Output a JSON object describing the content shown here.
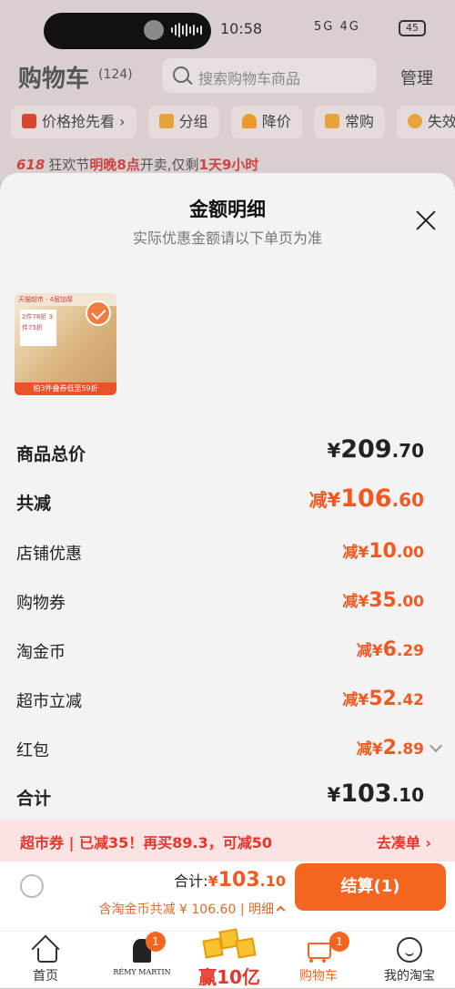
{
  "status_bar": {
    "time": "10:58",
    "battery": "45",
    "signal": "5G 4G"
  },
  "cart_header": {
    "title": "购物车",
    "count": "(124)",
    "search_placeholder": "搜索购物车商品",
    "manage": "管理"
  },
  "filter_chips": [
    {
      "label": "价格抢先看 ›",
      "icon": "price-tag-icon"
    },
    {
      "label": "分组",
      "icon": "folder-icon"
    },
    {
      "label": "降价",
      "icon": "down-arrow-icon"
    },
    {
      "label": "常购",
      "icon": "bag-icon"
    },
    {
      "label": "失效",
      "icon": "invalid-icon"
    }
  ],
  "promo_banner": {
    "tag": "618",
    "text1": "狂欢节",
    "highlight1": "明晚8点",
    "text2": "开卖,仅剩",
    "highlight2": "1天9小时"
  },
  "sheet": {
    "title": "金额明细",
    "subtitle": "实际优惠金额请以下单页为准",
    "product": {
      "top_text": "天猫超市 · 4层加厚",
      "badge_text": "2件78折 3件75折",
      "bottom_text": "拍3件叠券低至59折"
    },
    "rows": [
      {
        "label": "商品总价",
        "prefix": "",
        "yen": "¥",
        "int": "209",
        "dec": ".70",
        "style": "black-big"
      },
      {
        "label": "共减",
        "prefix": "减",
        "yen": "¥",
        "int": "106",
        "dec": ".60",
        "style": "orange-big"
      },
      {
        "label": "店铺优惠",
        "prefix": "减",
        "yen": "¥",
        "int": "10",
        "dec": ".00",
        "style": "orange-mid"
      },
      {
        "label": "购物券",
        "prefix": "减",
        "yen": "¥",
        "int": "35",
        "dec": ".00",
        "style": "orange-mid"
      },
      {
        "label": "淘金币",
        "prefix": "减",
        "yen": "¥",
        "int": "6",
        "dec": ".29",
        "style": "orange-mid"
      },
      {
        "label": "超市立减",
        "prefix": "减",
        "yen": "¥",
        "int": "52",
        "dec": ".42",
        "style": "orange-mid"
      },
      {
        "label": "红包",
        "prefix": "减",
        "yen": "¥",
        "int": "2",
        "dec": ".89",
        "style": "orange-mid"
      },
      {
        "label": "合计",
        "prefix": "",
        "yen": "¥",
        "int": "103",
        "dec": ".10",
        "style": "black-big"
      }
    ],
    "coupon": {
      "left": "超市券 | 已减35！再买89.3，可减50",
      "right": "去凑单 ›"
    }
  },
  "checkout": {
    "total_label": "合计:",
    "total_yen": "¥",
    "total_int": "103",
    "total_dec": ".10",
    "sub_text": "含淘金币共减 ¥ 106.60 |",
    "detail": "明细",
    "button": "结算(1)"
  },
  "bottom_nav": {
    "home": "首页",
    "brand_text": "RÉMY MARTIN",
    "brand_badge": "1",
    "promo_text": "赢10亿",
    "cart": "购物车",
    "cart_badge": "1",
    "profile": "我的淘宝"
  },
  "colors": {
    "accent": "#f4661f",
    "discount": "#f05a22",
    "coupon_red": "#e8352c"
  }
}
